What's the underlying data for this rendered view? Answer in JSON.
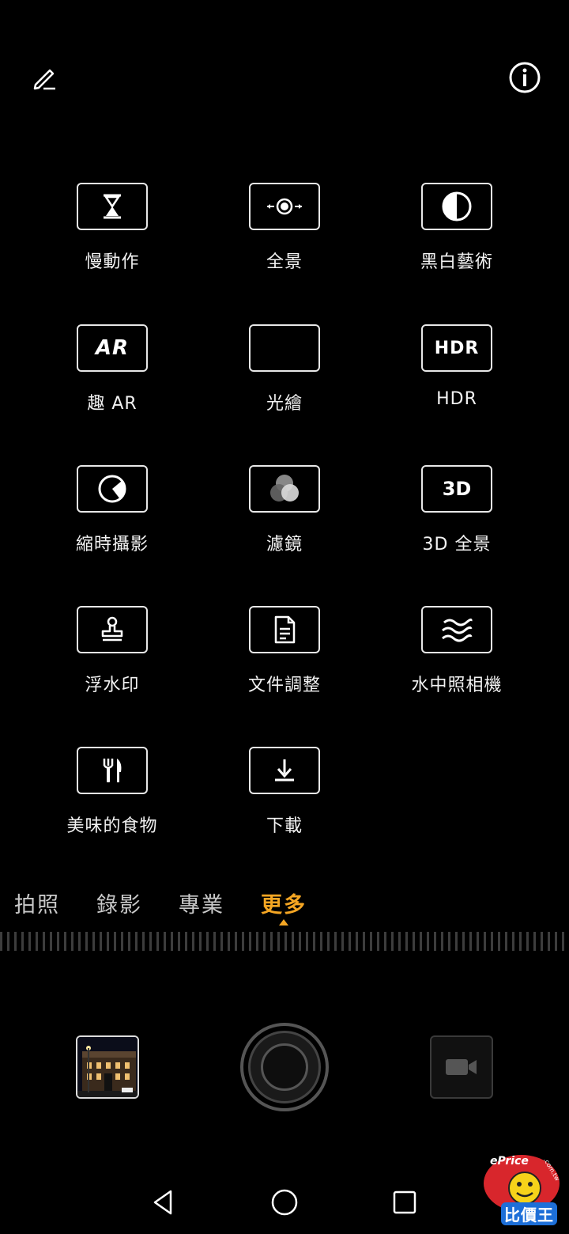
{
  "top_bar": {
    "edit_icon": "pencil-icon",
    "info_icon": "info-circle-icon"
  },
  "modes": [
    {
      "label": "慢動作",
      "icon": "hourglass-icon"
    },
    {
      "label": "全景",
      "icon": "panorama-icon"
    },
    {
      "label": "黑白藝術",
      "icon": "monochrome-icon"
    },
    {
      "label": "趣 AR",
      "icon": "ar-icon",
      "icon_text": "AR"
    },
    {
      "label": "光繪",
      "icon": "light-painting-icon"
    },
    {
      "label": "HDR",
      "icon": "hdr-icon",
      "icon_text": "HDR"
    },
    {
      "label": "縮時攝影",
      "icon": "timelapse-icon"
    },
    {
      "label": "濾鏡",
      "icon": "filter-icon"
    },
    {
      "label": "3D 全景",
      "icon": "3d-panorama-icon",
      "icon_text": "3D"
    },
    {
      "label": "浮水印",
      "icon": "watermark-stamp-icon"
    },
    {
      "label": "文件調整",
      "icon": "document-icon"
    },
    {
      "label": "水中照相機",
      "icon": "underwater-icon"
    },
    {
      "label": "美味的食物",
      "icon": "food-icon"
    },
    {
      "label": "下載",
      "icon": "download-icon"
    }
  ],
  "tabs": [
    {
      "label": "拍照",
      "active": false
    },
    {
      "label": "錄影",
      "active": false
    },
    {
      "label": "專業",
      "active": false
    },
    {
      "label": "更多",
      "active": true
    }
  ],
  "colors": {
    "accent": "#f5a623",
    "background": "#000000",
    "icon_stroke": "#e8e8e8"
  },
  "watermark": {
    "brand": "ePrice",
    "domain": ".com.tw",
    "text": "比價王"
  }
}
